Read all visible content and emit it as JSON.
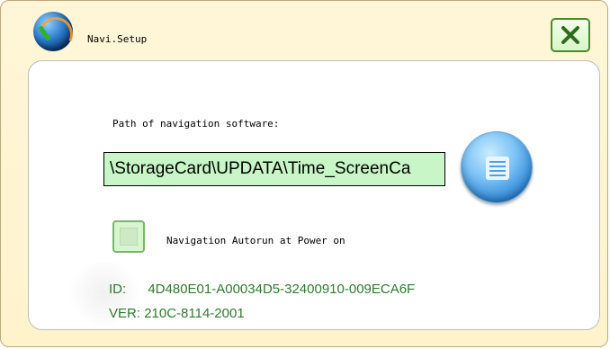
{
  "window": {
    "title": "Navi.Setup"
  },
  "path": {
    "label": "Path of navigation software:",
    "value": "\\StorageCard\\UPDATA\\Time_ScreenCa"
  },
  "autorun": {
    "label": "Navigation Autorun at Power on",
    "checked": false
  },
  "info": {
    "id_label": "ID:",
    "id_value": "4D480E01-A00034D5-32400910-009ECA6F",
    "ver_label": "VER:",
    "ver_value": "210C-8114-2001"
  },
  "colors": {
    "input_bg": "#c8f6c6",
    "info_text": "#2d7a2d",
    "close_accent": "#4a8a2a"
  },
  "icons": {
    "app": "globe-icon",
    "close": "close-icon",
    "browse": "list-icon"
  }
}
